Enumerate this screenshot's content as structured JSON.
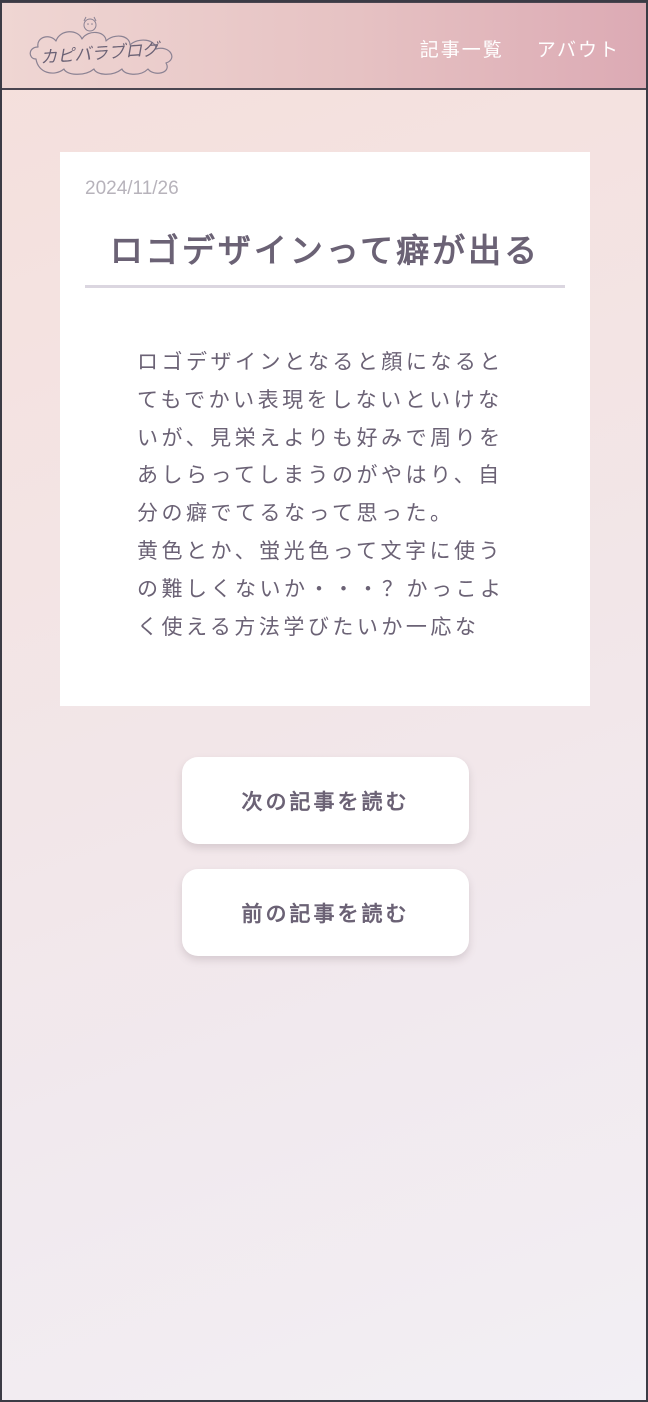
{
  "header": {
    "logo_text": "カピバラブログ",
    "nav": [
      {
        "label": "記事一覧"
      },
      {
        "label": "アバウト"
      }
    ]
  },
  "post": {
    "date": "2024/11/26",
    "title": "ロゴデザインって癖が出る",
    "body": "ロゴデザインとなると顔になるとてもでかい表現をしないといけないが、見栄えよりも好みで周りをあしらってしまうのがやはり、自分の癖でてるなって思った。\n黄色とか、蛍光色って文字に使うの難しくないか・・・？かっこよく使える方法学びたいか一応な"
  },
  "buttons": {
    "next_label": "次の記事を読む",
    "prev_label": "前の記事を読む"
  },
  "colors": {
    "text": "#6b6275",
    "date": "#b7b3bb",
    "header_start": "#efd6d3",
    "header_end": "#dcaab4"
  }
}
